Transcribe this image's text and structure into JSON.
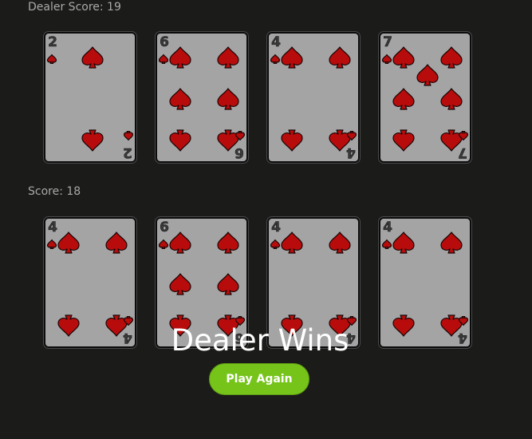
{
  "dealer": {
    "score_label": "Dealer Score: 19",
    "cards": [
      {
        "rank": "2",
        "suit": "spades"
      },
      {
        "rank": "6",
        "suit": "spades"
      },
      {
        "rank": "4",
        "suit": "spades"
      },
      {
        "rank": "7",
        "suit": "spades"
      }
    ]
  },
  "player": {
    "score_label": "Score: 18",
    "cards": [
      {
        "rank": "4",
        "suit": "spades"
      },
      {
        "rank": "6",
        "suit": "spades"
      },
      {
        "rank": "4",
        "suit": "spades"
      },
      {
        "rank": "4",
        "suit": "spades"
      }
    ]
  },
  "result_text": "Dealer Wins",
  "play_again_label": "Play Again",
  "colors": {
    "background": "#1b1b19",
    "card_face": "#a4a4a4",
    "suit_red": "#b80c0c",
    "button_green": "#76c41a"
  }
}
